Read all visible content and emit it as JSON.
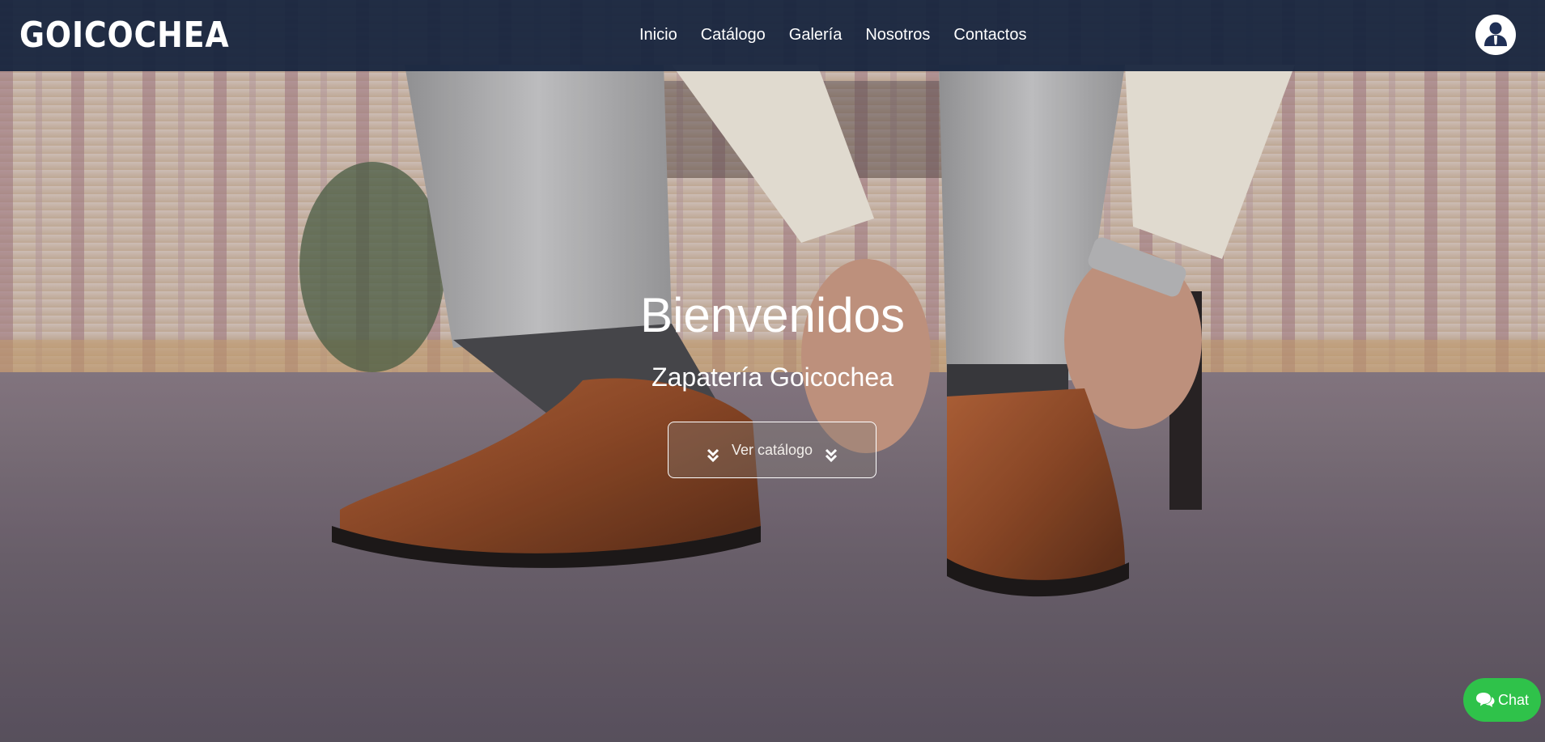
{
  "brand": {
    "name": "GOICOCHEA"
  },
  "nav": {
    "items": [
      {
        "label": "Inicio"
      },
      {
        "label": "Catálogo"
      },
      {
        "label": "Galería"
      },
      {
        "label": "Nosotros"
      },
      {
        "label": "Contactos"
      }
    ]
  },
  "user": {
    "icon": "user-avatar-icon"
  },
  "hero": {
    "title": "Bienvenidos",
    "subtitle": "Zapatería Goicochea",
    "cta_label": "Ver catálogo",
    "cta_icon": "chevrons-down-icon",
    "background": "photo of a man tying brown leather dress shoes on carpet"
  },
  "chat": {
    "label": "Chat",
    "icon": "chat-bubbles-icon",
    "color": "#2fc24a"
  },
  "colors": {
    "navbar": "#16243e",
    "text": "#ffffff"
  }
}
